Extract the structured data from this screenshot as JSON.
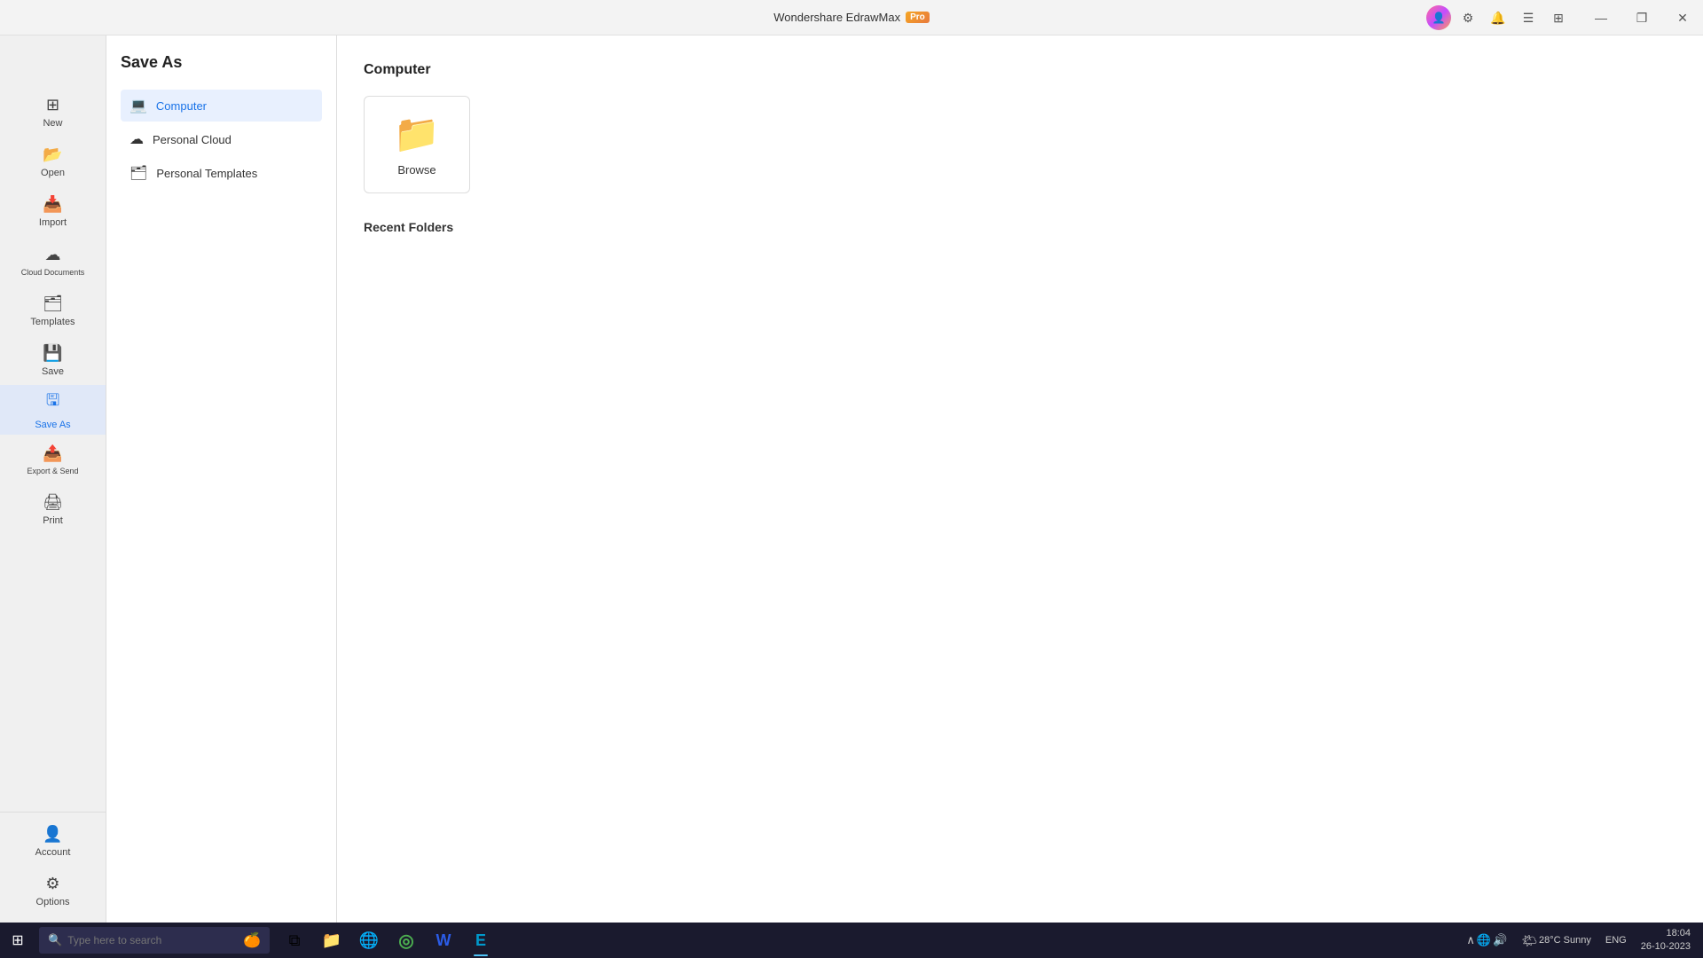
{
  "app": {
    "title": "Wondershare EdrawMax",
    "pro_badge": "Pro"
  },
  "title_bar": {
    "minimize": "—",
    "restore": "❐",
    "close": "✕"
  },
  "left_sidebar": {
    "back_label": "←",
    "items": [
      {
        "id": "new",
        "label": "New",
        "icon": "⊞"
      },
      {
        "id": "open",
        "label": "Open",
        "icon": "📂"
      },
      {
        "id": "import",
        "label": "Import",
        "icon": "📥"
      },
      {
        "id": "cloud-documents",
        "label": "Cloud Documents",
        "icon": "☁"
      },
      {
        "id": "templates",
        "label": "Templates",
        "icon": "🗂"
      },
      {
        "id": "save",
        "label": "Save",
        "icon": "💾"
      },
      {
        "id": "save-as",
        "label": "Save As",
        "icon": "🖫",
        "active": true
      },
      {
        "id": "export-send",
        "label": "Export & Send",
        "icon": "📤"
      },
      {
        "id": "print",
        "label": "Print",
        "icon": "🖨"
      }
    ],
    "bottom_items": [
      {
        "id": "account",
        "label": "Account",
        "icon": "👤"
      },
      {
        "id": "options",
        "label": "Options",
        "icon": "⚙"
      }
    ]
  },
  "save_as_panel": {
    "title": "Save As",
    "options": [
      {
        "id": "computer",
        "label": "Computer",
        "icon": "💻",
        "active": true
      },
      {
        "id": "personal-cloud",
        "label": "Personal Cloud",
        "icon": "☁"
      },
      {
        "id": "personal-templates",
        "label": "Personal Templates",
        "icon": "🗂"
      }
    ]
  },
  "main": {
    "section_title": "Computer",
    "browse_label": "Browse",
    "recent_folders_title": "Recent Folders"
  },
  "taskbar": {
    "start_icon": "⊞",
    "search_placeholder": "Type here to search",
    "search_emoji": "🍊",
    "apps": [
      {
        "id": "task-view",
        "icon": "⧉",
        "active": false
      },
      {
        "id": "file-explorer",
        "icon": "📁",
        "active": false
      },
      {
        "id": "edge",
        "icon": "🌐",
        "active": false
      },
      {
        "id": "chrome",
        "icon": "◎",
        "active": false
      },
      {
        "id": "word",
        "icon": "W",
        "active": false
      },
      {
        "id": "edrawmax",
        "icon": "E",
        "active": true
      }
    ],
    "system": {
      "weather": "28°C  Sunny",
      "weather_icon": "🌤",
      "lang": "ENG",
      "time": "18:04",
      "date": "26-10-2023"
    }
  }
}
